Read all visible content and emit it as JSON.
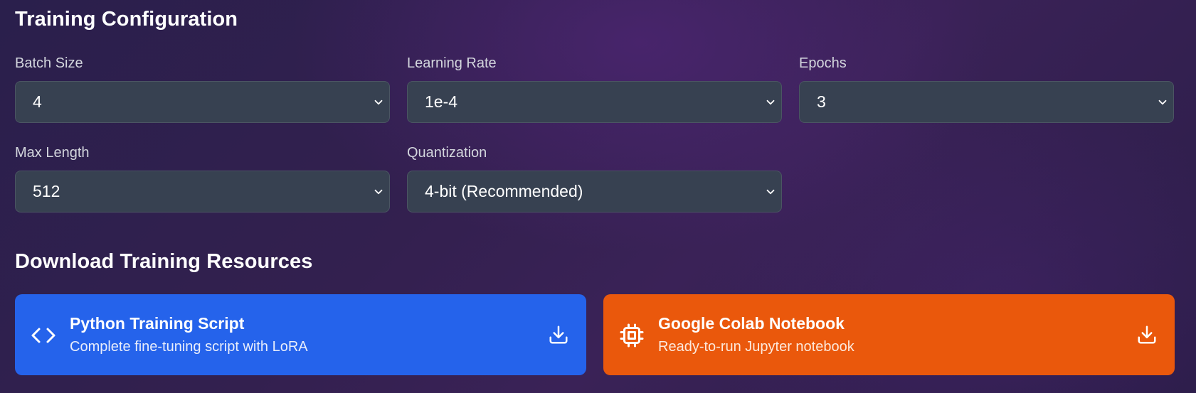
{
  "training_config": {
    "title": "Training Configuration",
    "fields": [
      {
        "label": "Batch Size",
        "value": "4"
      },
      {
        "label": "Learning Rate",
        "value": "1e-4"
      },
      {
        "label": "Epochs",
        "value": "3"
      },
      {
        "label": "Max Length",
        "value": "512"
      },
      {
        "label": "Quantization",
        "value": "4-bit (Recommended)"
      }
    ],
    "dropdown_icon": "chevron-down-icon"
  },
  "download": {
    "title": "Download Training Resources",
    "cards": [
      {
        "title": "Python Training Script",
        "description": "Complete fine-tuning script with LoRA",
        "icon": "code-icon",
        "action_icon": "download-icon",
        "color": "#2563eb"
      },
      {
        "title": "Google Colab Notebook",
        "description": "Ready-to-run Jupyter notebook",
        "icon": "cpu-chip-icon",
        "action_icon": "download-icon",
        "color": "#ea580c"
      }
    ]
  },
  "colors": {
    "select_background": "#374151",
    "label_text": "#d3d6dd",
    "page_background": "#2f1f4f"
  }
}
